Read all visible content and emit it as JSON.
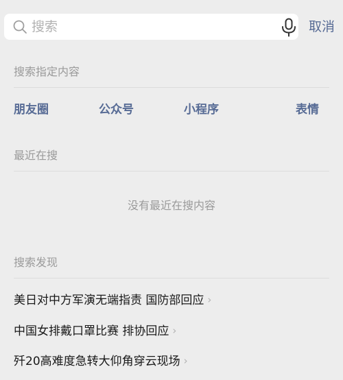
{
  "search": {
    "placeholder": "搜索",
    "cancel_label": "取消"
  },
  "specified": {
    "title": "搜索指定内容",
    "types": [
      "朋友圈",
      "公众号",
      "小程序",
      "表情"
    ]
  },
  "recent": {
    "title": "最近在搜",
    "empty_text": "没有最近在搜内容"
  },
  "discover": {
    "title": "搜索发现",
    "items": [
      "美日对中方军演无端指责 国防部回应",
      "中国女排戴口罩比赛 排协回应",
      "歼20高难度急转大仰角穿云现场"
    ]
  },
  "colors": {
    "accent": "#576b95",
    "background": "#ededed",
    "muted": "#9a9a9a"
  },
  "icons": {
    "search": "search-icon",
    "microphone": "microphone-icon",
    "chevron": "chevron-right-icon"
  }
}
